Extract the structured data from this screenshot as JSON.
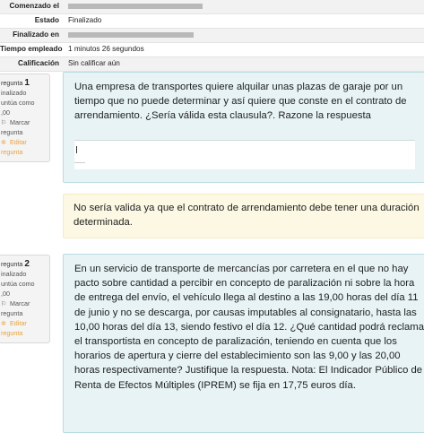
{
  "summary": {
    "rows": [
      {
        "label": "Comenzado el",
        "value": ""
      },
      {
        "label": "Estado",
        "value": "Finalizado"
      },
      {
        "label": "Finalizado en",
        "value": ""
      },
      {
        "label": "Tiempo empleado",
        "value": "1 minutos 26 segundos"
      },
      {
        "label": "Calificación",
        "value": "Sin calificar aún"
      }
    ]
  },
  "questions": [
    {
      "prefix": "regunta",
      "number": "1",
      "state": "inalizado",
      "mark_line1": "untúa como",
      "mark_line2": ",00",
      "flag_label": "Marcar",
      "flag_label2": "regunta",
      "edit_label": "Editar",
      "edit_label2": "regunta",
      "text": "Una empresa de transportes quiere alquilar unas plazas de garaje por un tiempo que no puede determinar y así quiere que conste en el contrato de arrendamiento. ¿Sería válida esta clausula?. Razone la respuesta",
      "feedback": "No sería valida ya que el contrato de arrendamiento debe tener una duración determinada."
    },
    {
      "prefix": "regunta",
      "number": "2",
      "state": "inalizado",
      "mark_line1": "untúa como",
      "mark_line2": ",00",
      "flag_label": "Marcar",
      "flag_label2": "regunta",
      "edit_label": "Editar",
      "edit_label2": "regunta",
      "text": "En un servicio de transporte de mercancías por carretera en el que no hay pacto sobre cantidad a percibir en concepto de paralización ni sobre la hora de entrega del envío, el vehículo llega al destino a las 19,00 horas del día 11 de junio y no se descarga, por causas imputables al consignatario, hasta las 10,00 horas del día 13, siendo festivo el día 12. ¿Qué cantidad podrá reclamar el transportista en concepto de paralización, teniendo en cuenta que los horarios de apertura y cierre del establecimiento son las 9,00 y las 20,00 horas respectivamente? Justifique la respuesta. Nota: El Indicador Público de Renta de Efectos Múltiples (IPREM) se fija en 17,75 euros día."
    }
  ]
}
